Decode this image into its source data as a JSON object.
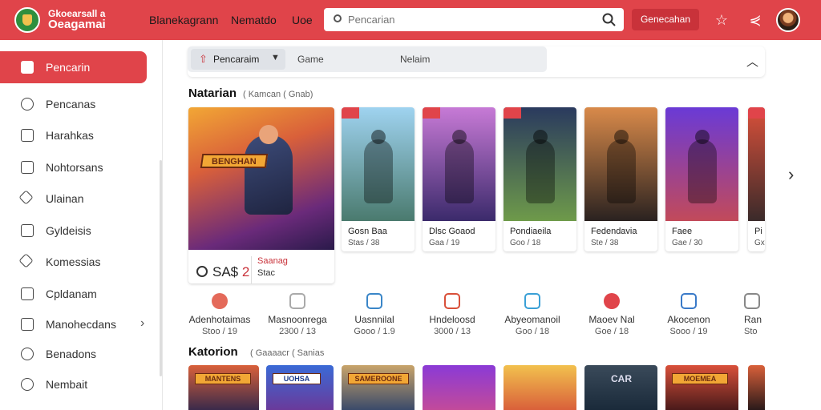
{
  "header": {
    "brand_line1": "Gkoearsall a",
    "brand_line2": "Oeagamai",
    "nav": [
      "Blanekagrann",
      "Nematdo",
      "Uoe"
    ],
    "search_placeholder": "Pencarian",
    "action_label": "Genecahan",
    "accent": "#e0444a"
  },
  "sidebar": {
    "items": [
      {
        "label": "Pencarin",
        "icon": "home-icon"
      },
      {
        "label": "Pencanas",
        "icon": "user-icon"
      },
      {
        "label": "Harahkas",
        "icon": "list-icon"
      },
      {
        "label": "Nohtorsans",
        "icon": "square-icon"
      },
      {
        "label": "Ulainan",
        "icon": "tag-icon"
      },
      {
        "label": "Gyldeisis",
        "icon": "edit-icon"
      },
      {
        "label": "Komessias",
        "icon": "diamond-icon"
      },
      {
        "label": "Cpldanam",
        "icon": "box-icon"
      },
      {
        "label": "Manohecdans",
        "icon": "folder-icon"
      },
      {
        "label": "Benadons",
        "icon": "circle-icon"
      },
      {
        "label": "Nembait",
        "icon": "help-icon"
      }
    ]
  },
  "filter": {
    "dropdown_label": "Pencaraim",
    "options": [
      "Game",
      "Nelaim"
    ]
  },
  "section1": {
    "title": "Natarian",
    "subtitle": "( Kamcan ( Gnab)",
    "featured": {
      "banner": "BENGHAN",
      "price_prefix": "O",
      "price": "SA$",
      "price_num": "2",
      "right1": "Saanag",
      "right2": "Stac"
    },
    "cards": [
      {
        "name": "Gosn Baa",
        "stat": "Stas / 38",
        "colors": [
          "#9fd3f0",
          "#4a7a6e"
        ]
      },
      {
        "name": "Dlsc Goaod",
        "stat": "Gaa / 19",
        "colors": [
          "#c77ad6",
          "#3b2a6b"
        ]
      },
      {
        "name": "Pondiaeila",
        "stat": "Goo / 18",
        "colors": [
          "#2a3a5e",
          "#6e9a4a"
        ]
      },
      {
        "name": "Fedendavia",
        "stat": "Ste / 38",
        "colors": [
          "#d98a4a",
          "#2a2220"
        ]
      },
      {
        "name": "Faee",
        "stat": "Gae / 30",
        "colors": [
          "#6a3ad6",
          "#c24a5a"
        ]
      },
      {
        "name": "Pi",
        "stat": "Gx",
        "colors": [
          "#d9503a",
          "#3a2a2a"
        ]
      }
    ]
  },
  "categories": [
    {
      "label": "Adenhotaimas",
      "stat": "Stoo / 19",
      "color": "#e46a5a"
    },
    {
      "label": "Masnoonrega",
      "stat": "2300 / 13",
      "color": "#aaaaaa"
    },
    {
      "label": "Uasnnilal",
      "stat": "Gooo / 1.9",
      "color": "#3a86c8"
    },
    {
      "label": "Hndeloosd",
      "stat": "3000 / 13",
      "color": "#d9503a"
    },
    {
      "label": "Abyeomanoil",
      "stat": "Goo / 18",
      "color": "#3aa0d6"
    },
    {
      "label": "Maoev Nal",
      "stat": "Goe / 18",
      "color": "#e0444a"
    },
    {
      "label": "Akocenon",
      "stat": "Sooo / 19",
      "color": "#3a7ac8"
    },
    {
      "label": "Ran",
      "stat": "Sto",
      "color": "#888888"
    }
  ],
  "section2": {
    "title": "Katorion",
    "subtitle": "( Gaaaacr ( Sanias",
    "cards": [
      {
        "tag": "MANTENS",
        "colors": [
          "#d9603a",
          "#3a2a4a"
        ]
      },
      {
        "tag": "UOHSA",
        "colors": [
          "#3a6ad6",
          "#6a3a9a"
        ]
      },
      {
        "tag": "SAMEROONE",
        "colors": [
          "#c8a46a",
          "#3a4a6a"
        ]
      },
      {
        "tag": "",
        "colors": [
          "#8a3ad6",
          "#c24a9a"
        ]
      },
      {
        "tag": "",
        "colors": [
          "#f2c14e",
          "#d9603a"
        ]
      },
      {
        "tag": "CAR",
        "colors": [
          "#3a4a5a",
          "#1a2a3a"
        ]
      },
      {
        "tag": "MOEMEA",
        "colors": [
          "#d9503a",
          "#4a1a1a"
        ]
      },
      {
        "tag": "",
        "colors": [
          "#d9603a",
          "#2a1a1a"
        ]
      }
    ]
  }
}
